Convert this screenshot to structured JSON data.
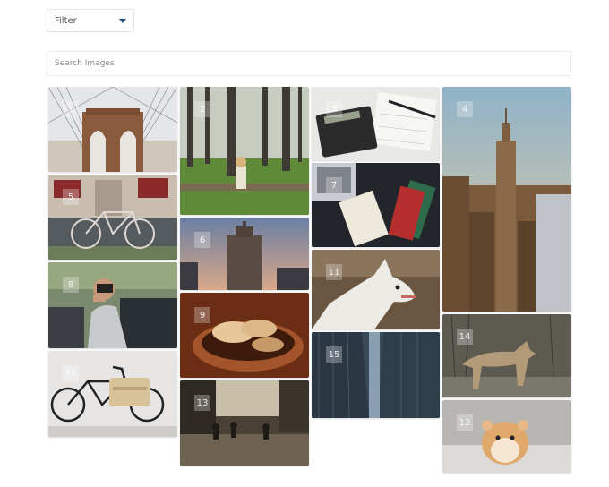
{
  "filter": {
    "label": "Filter",
    "icon": "chevron-down-icon",
    "accent": "#1b4f8a"
  },
  "search": {
    "placeholder": "Search Images",
    "value": ""
  },
  "gallery": {
    "tiles": [
      {
        "num": "1",
        "subject": "brooklyn-bridge"
      },
      {
        "num": "2",
        "subject": "girl-in-forest"
      },
      {
        "num": "3",
        "subject": "calculator-and-pen"
      },
      {
        "num": "4",
        "subject": "empire-state-building"
      },
      {
        "num": "5",
        "subject": "bicycle-on-street"
      },
      {
        "num": "6",
        "subject": "city-skyscraper-dusk"
      },
      {
        "num": "7",
        "subject": "laptop-and-notebook"
      },
      {
        "num": "8",
        "subject": "photographer"
      },
      {
        "num": "9",
        "subject": "bread-basket"
      },
      {
        "num": "10",
        "subject": "bicycle-with-basket"
      },
      {
        "num": "11",
        "subject": "white-dog"
      },
      {
        "num": "12",
        "subject": "hamster"
      },
      {
        "num": "13",
        "subject": "city-street-silhouettes"
      },
      {
        "num": "14",
        "subject": "wolf"
      },
      {
        "num": "15",
        "subject": "city-buildings"
      }
    ]
  }
}
